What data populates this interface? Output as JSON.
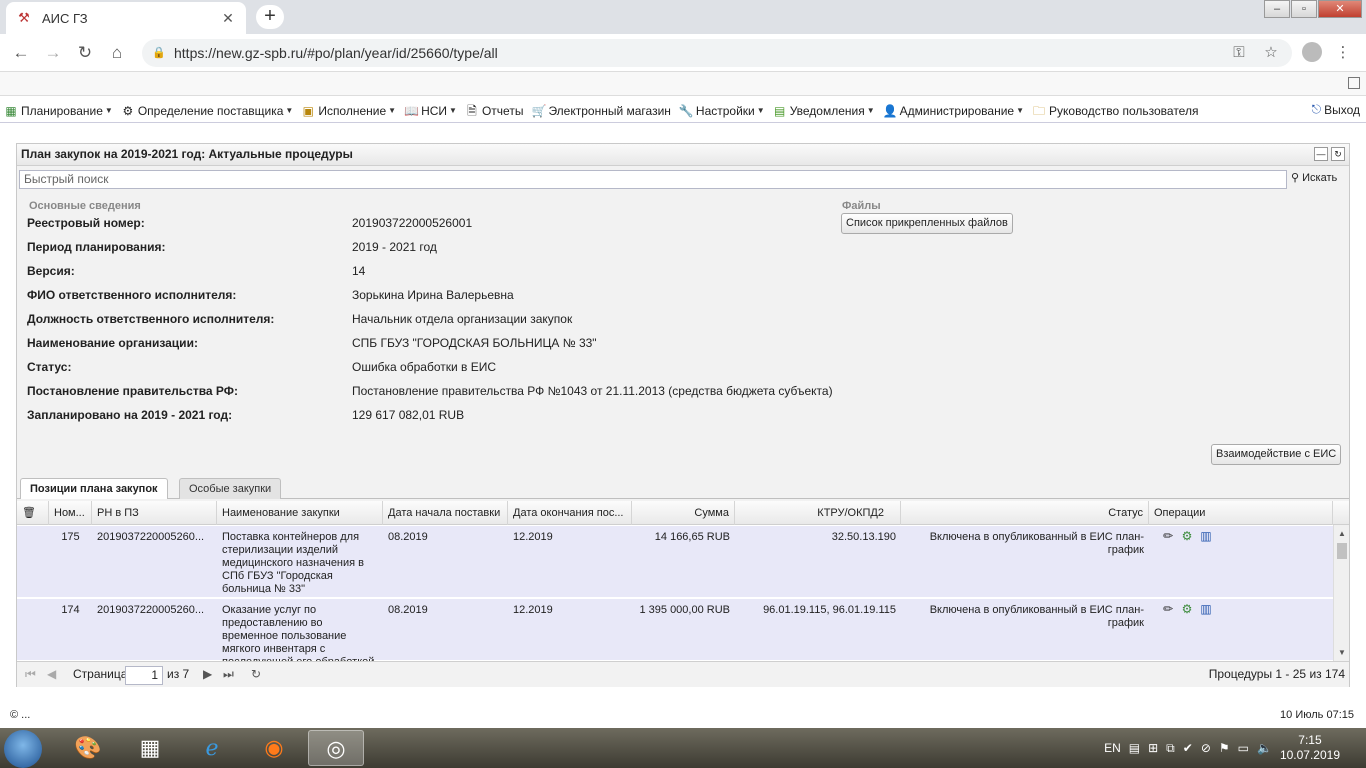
{
  "browser": {
    "tab_title": "АИС ГЗ",
    "new_tab": "+",
    "url": "https://new.gz-spb.ru/#po/plan/year/id/25660/type/all",
    "win_min": "‒",
    "win_max": "▫",
    "win_close": "✕"
  },
  "menu": {
    "items": [
      {
        "label": "Планирование",
        "icon": "planning-icon",
        "arrow": true
      },
      {
        "label": "Определение поставщика",
        "icon": "supplier-icon",
        "arrow": true
      },
      {
        "label": "Исполнение",
        "icon": "execution-icon",
        "arrow": true
      },
      {
        "label": "НСИ",
        "icon": "nsi-icon",
        "arrow": true
      },
      {
        "label": "Отчеты",
        "icon": "reports-icon",
        "arrow": false
      },
      {
        "label": "Электронный магазин",
        "icon": "shop-icon",
        "arrow": false
      },
      {
        "label": "Настройки",
        "icon": "settings-icon",
        "arrow": true
      },
      {
        "label": "Уведомления",
        "icon": "notifications-icon",
        "arrow": true
      },
      {
        "label": "Администрирование",
        "icon": "admin-icon",
        "arrow": true
      },
      {
        "label": "Руководство пользователя",
        "icon": "manual-icon",
        "arrow": false
      }
    ],
    "exit_label": "Выход"
  },
  "panel": {
    "title": "План закупок на 2019-2021 год: Актуальные процедуры",
    "search_placeholder": "Быстрый поиск",
    "search_button": "Искать",
    "section_main": "Основные сведения",
    "section_files": "Файлы",
    "files_button": "Список прикрепленных файлов",
    "eis_button": "Взаимодействие с ЕИС",
    "fields": [
      {
        "label": "Реестровый номер:",
        "value": "201903722000526001"
      },
      {
        "label": "Период планирования:",
        "value": "2019 - 2021 год"
      },
      {
        "label": "Версия:",
        "value": "14"
      },
      {
        "label": "ФИО ответственного исполнителя:",
        "value": "Зорькина Ирина Валерьевна"
      },
      {
        "label": "Должность ответственного исполнителя:",
        "value": "Начальник отдела организации закупок"
      },
      {
        "label": "Наименование организации:",
        "value": "СПБ ГБУЗ \"ГОРОДСКАЯ БОЛЬНИЦА № 33\""
      },
      {
        "label": "Статус:",
        "value": "Ошибка обработки в ЕИС"
      },
      {
        "label": "Постановление правительства РФ:",
        "value": "Постановление правительства РФ №1043 от 21.11.2013 (средства бюджета субъекта)"
      },
      {
        "label": "Запланировано на 2019 - 2021 год:",
        "value": "129 617 082,01 RUB"
      }
    ]
  },
  "tabs": [
    "Позиции плана закупок",
    "Особые закупки"
  ],
  "grid": {
    "columns": [
      "Ном...",
      "РН в ПЗ",
      "Наименование закупки",
      "Дата начала поставки",
      "Дата окончания пос...",
      "Сумма",
      "КТРУ/ОКПД2",
      "Статус",
      "Операции"
    ],
    "rows": [
      {
        "num": "175",
        "rn": "2019037220005260...",
        "name": "Поставка контейнеров для стерилизации изделий медицинского назначения в СПб ГБУЗ \"Городская больница № 33\"",
        "start": "08.2019",
        "end": "12.2019",
        "sum": "14 166,65 RUB",
        "ktru": "32.50.13.190",
        "status": "Включена в опубликованный в ЕИС план-график"
      },
      {
        "num": "174",
        "rn": "2019037220005260...",
        "name": "Оказание услуг по предоставлению во временное пользование мягкого инвентаря с последующей его обработкой",
        "start": "08.2019",
        "end": "12.2019",
        "sum": "1 395 000,00 RUB",
        "ktru": "96.01.19.115, 96.01.19.115",
        "status": "Включена в опубликованный в ЕИС план-график"
      }
    ]
  },
  "pager": {
    "page_label": "Страница",
    "page_value": "1",
    "of_label": "из 7",
    "summary": "Процедуры 1 - 25 из 174"
  },
  "footer": {
    "copyright": "© ...",
    "datetime": "10 Июль 07:15"
  },
  "taskbar": {
    "lang": "EN",
    "time": "7:15",
    "date": "10.07.2019"
  }
}
